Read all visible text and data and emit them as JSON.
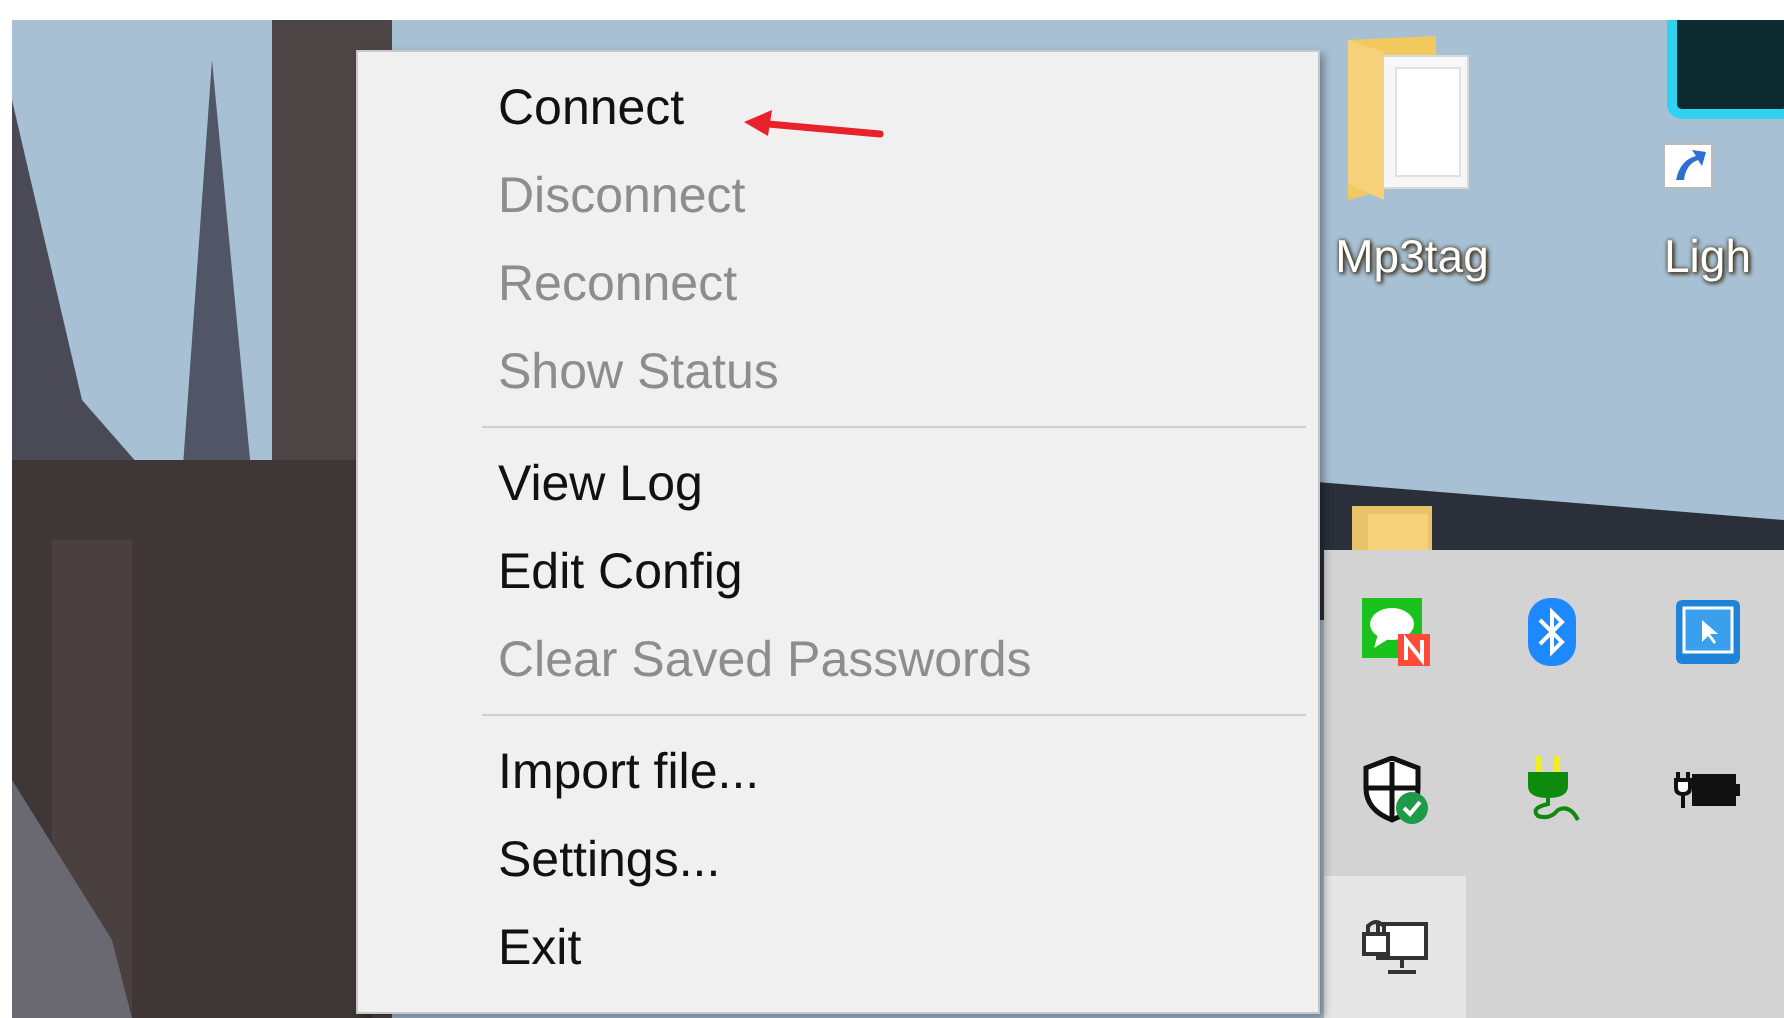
{
  "desktop_icons": [
    {
      "kind": "folder",
      "label": "Mp3tag"
    },
    {
      "kind": "app-shortcut",
      "label": "Ligh"
    }
  ],
  "menu": {
    "items": [
      {
        "kind": "item",
        "label": "Connect",
        "disabled": false
      },
      {
        "kind": "item",
        "label": "Disconnect",
        "disabled": true
      },
      {
        "kind": "item",
        "label": "Reconnect",
        "disabled": true
      },
      {
        "kind": "item",
        "label": "Show Status",
        "disabled": true
      },
      {
        "kind": "separator"
      },
      {
        "kind": "item",
        "label": "View Log",
        "disabled": false
      },
      {
        "kind": "item",
        "label": "Edit Config",
        "disabled": false
      },
      {
        "kind": "item",
        "label": "Clear Saved Passwords",
        "disabled": true
      },
      {
        "kind": "separator"
      },
      {
        "kind": "item",
        "label": "Import file...",
        "disabled": false
      },
      {
        "kind": "item",
        "label": "Settings...",
        "disabled": false
      },
      {
        "kind": "item",
        "label": "Exit",
        "disabled": false
      }
    ]
  },
  "tray_icons": [
    {
      "kind": "chat",
      "hovered": false
    },
    {
      "kind": "bluetooth",
      "hovered": false
    },
    {
      "kind": "cursor-window",
      "hovered": false
    },
    {
      "kind": "shield",
      "hovered": false
    },
    {
      "kind": "plug",
      "hovered": false
    },
    {
      "kind": "battery",
      "hovered": false
    },
    {
      "kind": "lock-monitor",
      "hovered": true
    }
  ]
}
